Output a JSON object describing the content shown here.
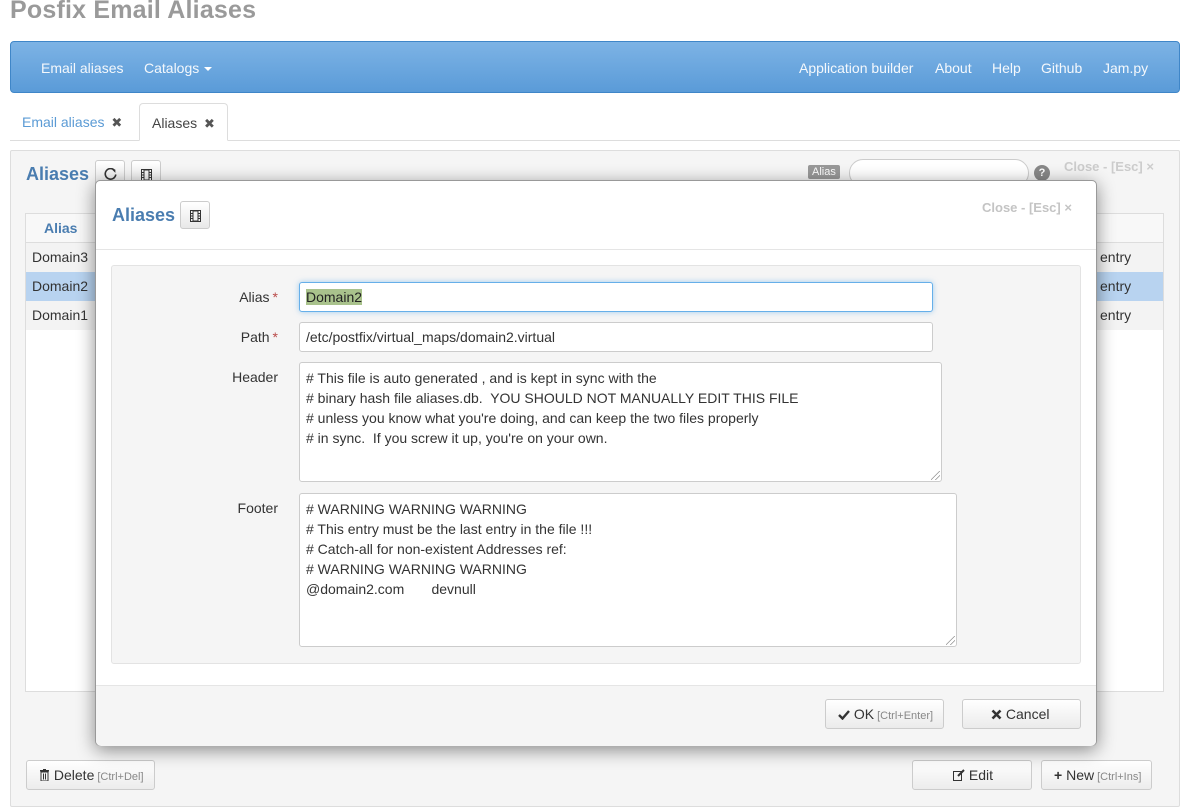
{
  "app_title": "Posfix Email Aliases",
  "navbar": {
    "left": [
      "Email aliases",
      "Catalogs"
    ],
    "right": [
      "Application builder",
      "About",
      "Help",
      "Github",
      "Jam.py"
    ]
  },
  "tabs": [
    {
      "label": "Email aliases",
      "close": "✖"
    },
    {
      "label": "Aliases",
      "close": "✖"
    }
  ],
  "panel": {
    "title": "Aliases",
    "refresh_icon": "refresh-icon",
    "layout_icon": "film-icon",
    "search_label": "Alias",
    "search_value": "",
    "help": "?",
    "close_text": "Close - [Esc] ×",
    "columns": [
      "Alias"
    ],
    "rows": [
      {
        "alias": "Domain3",
        "tail": "entry"
      },
      {
        "alias": "Domain2",
        "tail": "entry"
      },
      {
        "alias": "Domain1",
        "tail": "entry"
      }
    ],
    "selected_row": 1,
    "delete_button": {
      "icon": "trash-icon",
      "label": "Delete",
      "hint": "[Ctrl+Del]"
    },
    "edit_button": {
      "icon": "edit-icon",
      "label": "Edit"
    },
    "new_button": {
      "icon": "plus-icon",
      "label": "New",
      "hint": "[Ctrl+Ins]"
    }
  },
  "modal": {
    "title": "Aliases",
    "layout_icon": "film-icon",
    "close_text": "Close - [Esc] ×",
    "fields": {
      "alias": {
        "label": "Alias",
        "required": "*",
        "value": "Domain2"
      },
      "path": {
        "label": "Path",
        "required": "*",
        "value": "/etc/postfix/virtual_maps/domain2.virtual"
      },
      "header": {
        "label": "Header",
        "value": "# This file is auto generated , and is kept in sync with the\n# binary hash file aliases.db.  YOU SHOULD NOT MANUALLY EDIT THIS FILE\n# unless you know what you're doing, and can keep the two files properly\n# in sync.  If you screw it up, you're on your own."
      },
      "footer": {
        "label": "Footer",
        "value": "# WARNING WARNING WARNING\n# This entry must be the last entry in the file !!!\n# Catch-all for non-existent Addresses ref:\n# WARNING WARNING WARNING\n@domain2.com       devnull"
      }
    },
    "ok_button": {
      "icon": "check-icon",
      "label": "OK",
      "hint": "[Ctrl+Enter]"
    },
    "cancel_button": {
      "icon": "x-icon",
      "label": "Cancel"
    }
  }
}
